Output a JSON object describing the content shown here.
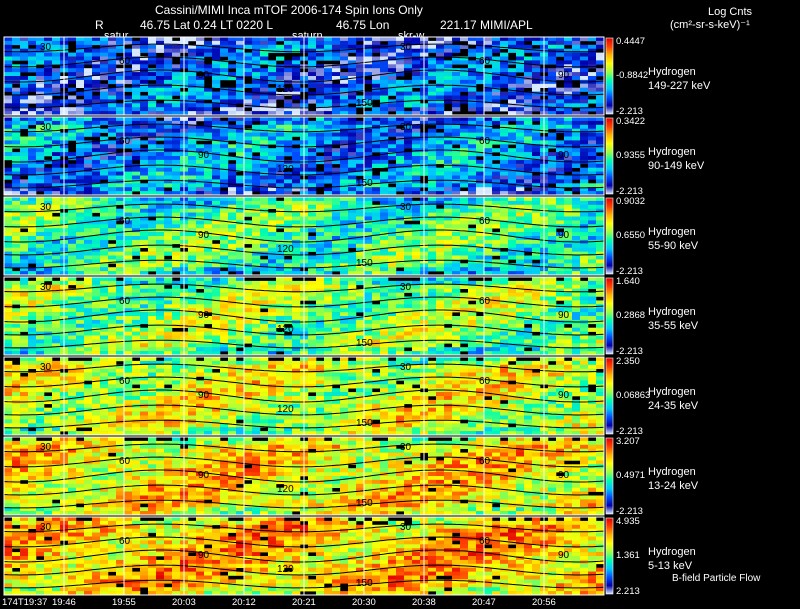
{
  "header": {
    "title": "Cassini/MIMI Inca mTOF  2006-174   Spin    Ions Only",
    "subtitle": {
      "r_label": "R",
      "position": "46.75 Lat 0.24 LT 0220 L",
      "lon": "46.75 Lon",
      "extra": "221.17  MIMI/APL"
    },
    "markers": [
      "satur",
      "saturn",
      "skr-w"
    ],
    "units_line1": "Log Cnts",
    "units_line2": "(cm²-sr-s-keV)⁻¹"
  },
  "footer": {
    "legend": "B-field Particle Flow"
  },
  "colors": {
    "background": "#000000",
    "grid": "#ffffff",
    "contour": "#000000",
    "colorbar": [
      "#d8e8ff",
      "#0000aa",
      "#0050ff",
      "#00c8ff",
      "#00ffb0",
      "#a0ff40",
      "#ffff00",
      "#ffb000",
      "#ff4000",
      "#e00000"
    ]
  },
  "chart_data": {
    "type": "heatmap",
    "x_tick_labels": [
      "174T19:37",
      "19:46",
      "19:55",
      "20:03",
      "20:12",
      "20:21",
      "20:30",
      "20:38",
      "20:47",
      "20:56"
    ],
    "pitch_angle_labels": [
      "30",
      "60",
      "90",
      "120",
      "150"
    ],
    "panels": [
      {
        "species": "Hydrogen",
        "energy": "149-227 keV",
        "cbar_max": "0.4447",
        "cbar_mid": "-0.8842",
        "cbar_min": "-2.213",
        "level": 0.18
      },
      {
        "species": "Hydrogen",
        "energy": "90-149 keV",
        "cbar_max": "0.3422",
        "cbar_mid": "0.9355",
        "cbar_min": "-2.213",
        "level": 0.26
      },
      {
        "species": "Hydrogen",
        "energy": "55-90 keV",
        "cbar_max": "0.9032",
        "cbar_mid": "0.6550",
        "cbar_min": "-2.213",
        "level": 0.45
      },
      {
        "species": "Hydrogen",
        "energy": "35-55 keV",
        "cbar_max": "1.640",
        "cbar_mid": "0.2868",
        "cbar_min": "-2.213",
        "level": 0.52
      },
      {
        "species": "Hydrogen",
        "energy": "24-35 keV",
        "cbar_max": "2.350",
        "cbar_mid": "0.06863",
        "cbar_min": "-2.213",
        "level": 0.6
      },
      {
        "species": "Hydrogen",
        "energy": "13-24 keV",
        "cbar_max": "3.207",
        "cbar_mid": "0.4971",
        "cbar_min": "-2.213",
        "level": 0.67
      },
      {
        "species": "Hydrogen",
        "energy": "5-13 keV",
        "cbar_max": "4.935",
        "cbar_mid": "1.361",
        "cbar_min": "2.213",
        "level": 0.72
      }
    ]
  }
}
